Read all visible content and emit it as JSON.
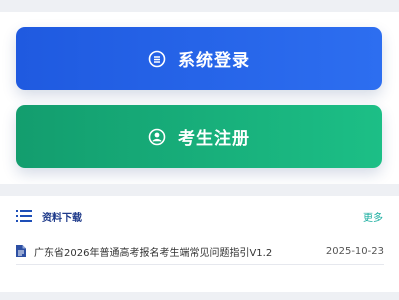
{
  "buttons": {
    "login_label": "系统登录",
    "register_label": "考生注册"
  },
  "downloads": {
    "title": "资料下载",
    "more_label": "更多",
    "items": [
      {
        "title": "广东省2026年普通高考报名考生端常见问题指引V1.2",
        "date": "2025-10-23"
      }
    ]
  },
  "colors": {
    "login_button": "#2462e8",
    "register_button": "#17ad79",
    "accent_title": "#1e3a8a",
    "more_link": "#1aaea0",
    "doc_icon": "#2d4fa3"
  },
  "icons": {
    "login": "login-icon",
    "register": "user-circle-icon",
    "list": "list-icon",
    "document": "document-icon"
  }
}
